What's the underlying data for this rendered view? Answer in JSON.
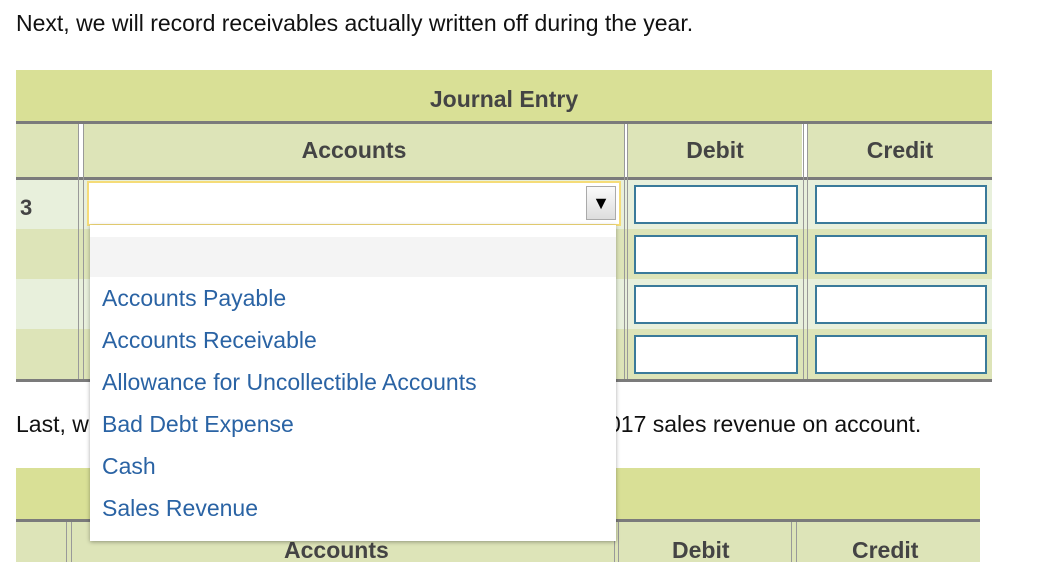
{
  "intro": "Next, we will record receivables actually written off during the year.",
  "table1": {
    "title": "Journal Entry",
    "col_accounts": "Accounts",
    "col_debit": "Debit",
    "col_credit": "Credit",
    "row_number": "3"
  },
  "dropdown": {
    "selected": "",
    "options": [
      "",
      "Accounts Payable",
      "Accounts Receivable",
      "Allowance for Uncollectible Accounts",
      "Bad Debt Expense",
      "Cash",
      "Sales Revenue"
    ]
  },
  "last_text_left": "Last, w",
  "last_text_right": "017 sales revenue on account.",
  "table2": {
    "col_accounts": "Accounts",
    "col_debit": "Debit",
    "col_credit": "Credit"
  }
}
